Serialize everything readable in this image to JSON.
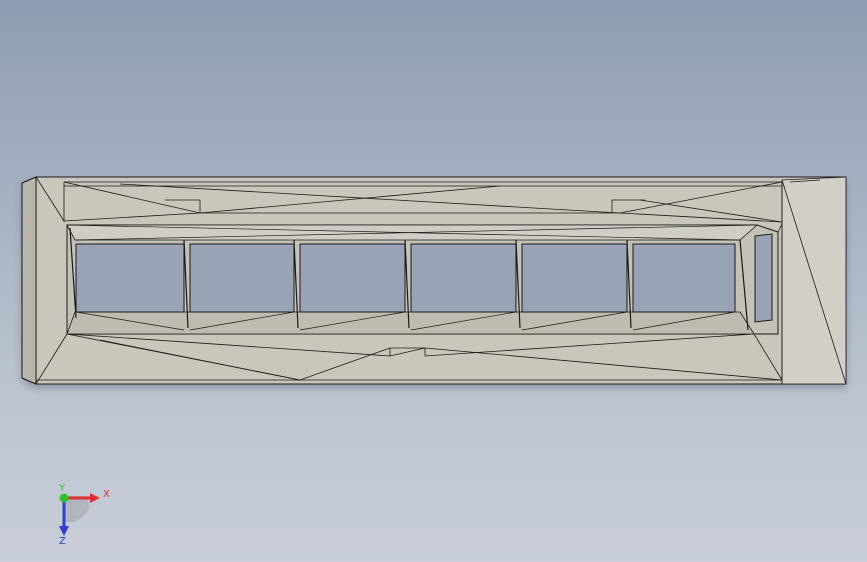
{
  "viewport": {
    "background_top": "#8e9db1",
    "background_bottom": "#c9ced8"
  },
  "model": {
    "face_color": "#c9c7bc",
    "edge_color": "#1a1a1a",
    "opening_color": "#98a4b5",
    "opening_count": 6
  },
  "triad": {
    "x_label": "X",
    "y_label": "Y",
    "z_label": "Z",
    "x_color": "#e03030",
    "y_color": "#2fbf2f",
    "z_color": "#2f3fd0"
  }
}
